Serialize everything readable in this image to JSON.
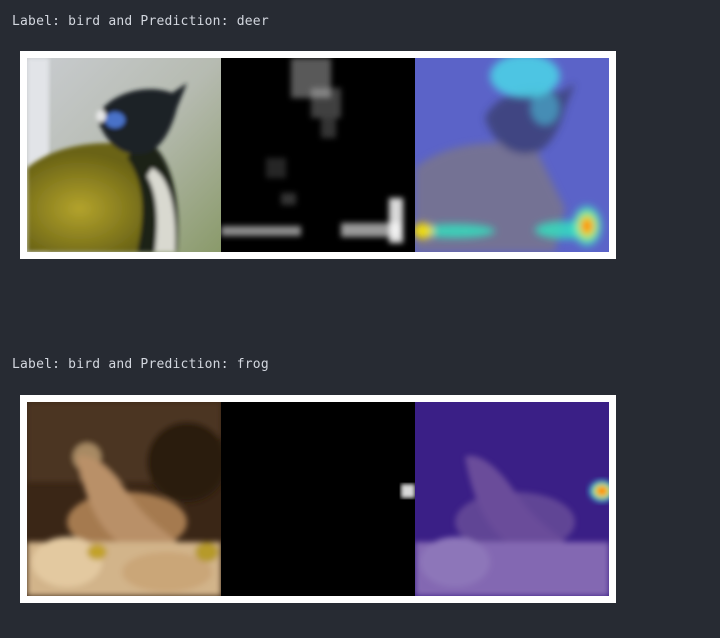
{
  "outputs": [
    {
      "label_text": "Label: bird and Prediction: deer",
      "panels": [
        {
          "name": "original-image",
          "alt": "bird photo"
        },
        {
          "name": "saliency-map",
          "alt": "grayscale activation map"
        },
        {
          "name": "heatmap-overlay",
          "alt": "heatmap overlay"
        }
      ]
    },
    {
      "label_text": "Label: bird and Prediction: frog",
      "panels": [
        {
          "name": "original-image",
          "alt": "bird photo"
        },
        {
          "name": "saliency-map",
          "alt": "grayscale activation map"
        },
        {
          "name": "heatmap-overlay",
          "alt": "heatmap overlay"
        }
      ]
    }
  ],
  "colors": {
    "background": "#272b33",
    "text": "#d3d7df",
    "frame": "#ffffff"
  }
}
